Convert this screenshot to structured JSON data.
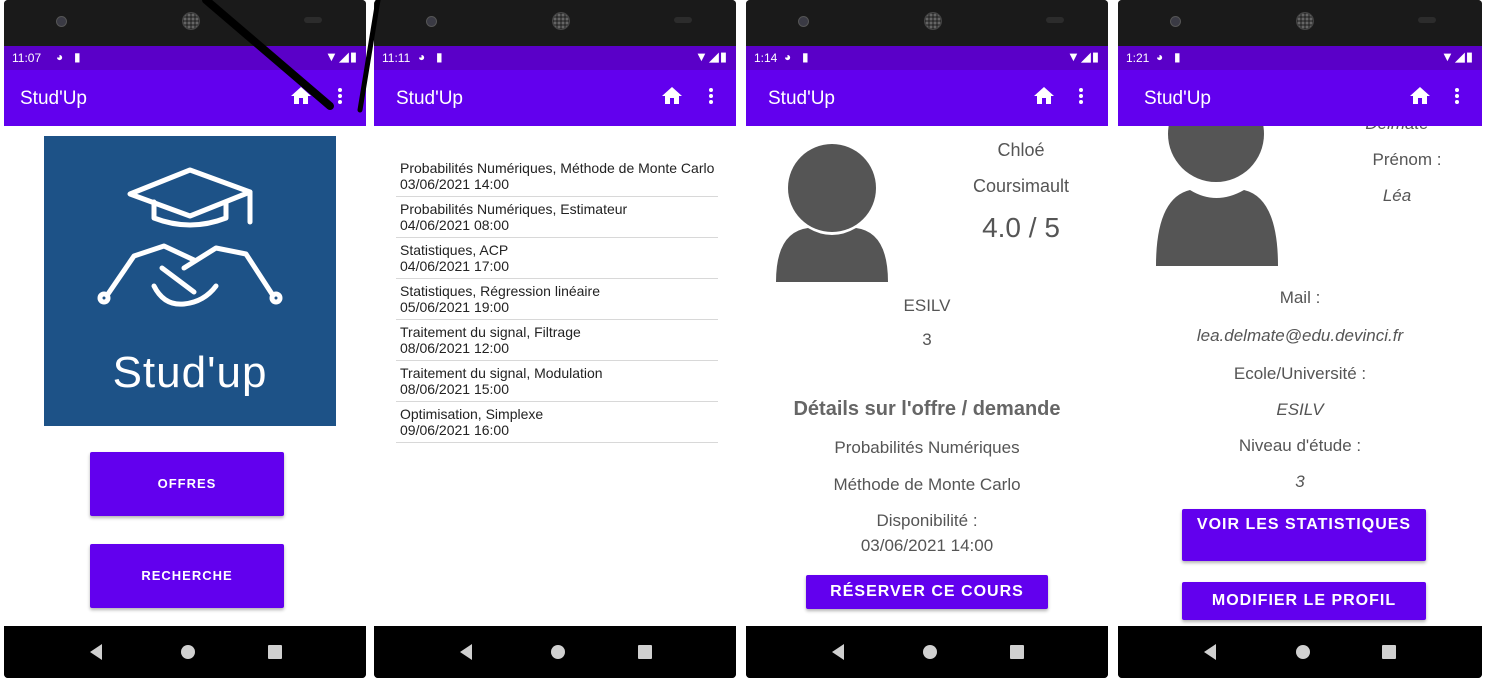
{
  "app_title": "Stud'Up",
  "screens": [
    {
      "status_time": "11:07",
      "logo_text": "Stud'up",
      "buttons": {
        "offres": "OFFRES",
        "recherche": "RECHERCHE"
      }
    },
    {
      "status_time": "11:11",
      "items": [
        {
          "title": "Probabilités Numériques, Méthode de Monte Carlo",
          "date": "03/06/2021 14:00"
        },
        {
          "title": "Probabilités Numériques, Estimateur",
          "date": "04/06/2021 08:00"
        },
        {
          "title": "Statistiques, ACP",
          "date": "04/06/2021 17:00"
        },
        {
          "title": "Statistiques, Régression linéaire",
          "date": "05/06/2021 19:00"
        },
        {
          "title": "Traitement du signal, Filtrage",
          "date": "08/06/2021 12:00"
        },
        {
          "title": "Traitement du signal, Modulation",
          "date": "08/06/2021 15:00"
        },
        {
          "title": "Optimisation, Simplexe",
          "date": "09/06/2021 16:00"
        }
      ]
    },
    {
      "status_time": "1:14",
      "firstname": "Chloé",
      "lastname": "Coursimault",
      "rating": "4.0 / 5",
      "school": "ESILV",
      "level": "3",
      "details_heading": "Détails sur l'offre / demande",
      "subject": "Probabilités Numériques",
      "topic": "Méthode de Monte Carlo",
      "availability_label": "Disponibilité :",
      "availability_value": "03/06/2021 14:00",
      "reserve_button": "RÉSERVER CE COURS"
    },
    {
      "status_time": "1:21",
      "lastname_partial": "Delmate",
      "firstname_label": "Prénom :",
      "firstname": "Léa",
      "mail_label": "Mail :",
      "mail": "lea.delmate@edu.devinci.fr",
      "school_label": "Ecole/Université :",
      "school": "ESILV",
      "level_label": "Niveau d'étude :",
      "level": "3",
      "stats_button": "VOIR LES STATISTIQUES",
      "edit_button": "MODIFIER LE PROFIL"
    }
  ],
  "colors": {
    "primary": "#6200ee",
    "status": "#5a00c8",
    "logo_bg": "#1d5287"
  }
}
